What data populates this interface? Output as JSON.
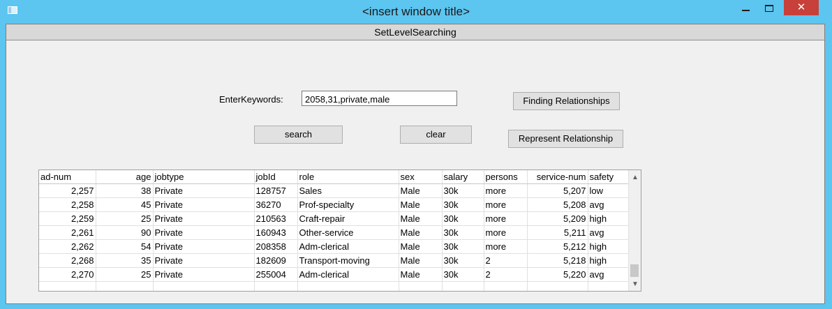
{
  "window": {
    "title": "<insert window title>",
    "close_label": "✕"
  },
  "form": {
    "title": "SetLevelSearching",
    "keywords_label": "EnterKeywords:",
    "keywords_value": "2058,31,private,male",
    "finding_button": "Finding Relationships",
    "search_button": "search",
    "clear_button": "clear",
    "represent_button": "Represent Relationship"
  },
  "table": {
    "columns": [
      "ad-num",
      "age",
      "jobtype",
      "jobId",
      "role",
      "sex",
      "salary",
      "persons",
      "service-num",
      "safety"
    ],
    "rows": [
      [
        "2,257",
        "38",
        "Private",
        "128757",
        "Sales",
        "Male",
        "30k",
        "more",
        "5,207",
        "low"
      ],
      [
        "2,258",
        "45",
        "Private",
        "36270",
        "Prof-specialty",
        "Male",
        "30k",
        "more",
        "5,208",
        "avg"
      ],
      [
        "2,259",
        "25",
        "Private",
        "210563",
        "Craft-repair",
        "Male",
        "30k",
        "more",
        "5,209",
        "high"
      ],
      [
        "2,261",
        "90",
        "Private",
        "160943",
        "Other-service",
        "Male",
        "30k",
        "more",
        "5,211",
        "avg"
      ],
      [
        "2,262",
        "54",
        "Private",
        "208358",
        "Adm-clerical",
        "Male",
        "30k",
        "more",
        "5,212",
        "high"
      ],
      [
        "2,268",
        "35",
        "Private",
        "182609",
        "Transport-moving",
        "Male",
        "30k",
        "2",
        "5,218",
        "high"
      ],
      [
        "2,270",
        "25",
        "Private",
        "255004",
        "Adm-clerical",
        "Male",
        "30k",
        "2",
        "5,220",
        "avg"
      ],
      [
        "",
        "",
        "",
        "",
        "",
        "",
        "",
        "",
        "",
        ""
      ]
    ]
  },
  "icons": {
    "app": "window-app-icon",
    "minimize": "minimize-icon",
    "maximize": "maximize-icon",
    "close": "close-icon",
    "scroll_up": "chevron-up-icon",
    "scroll_down": "chevron-down-icon"
  },
  "colors": {
    "title_bar": "#5cc5f0",
    "close_button": "#c7403a",
    "client_background": "#f0f0f0"
  }
}
